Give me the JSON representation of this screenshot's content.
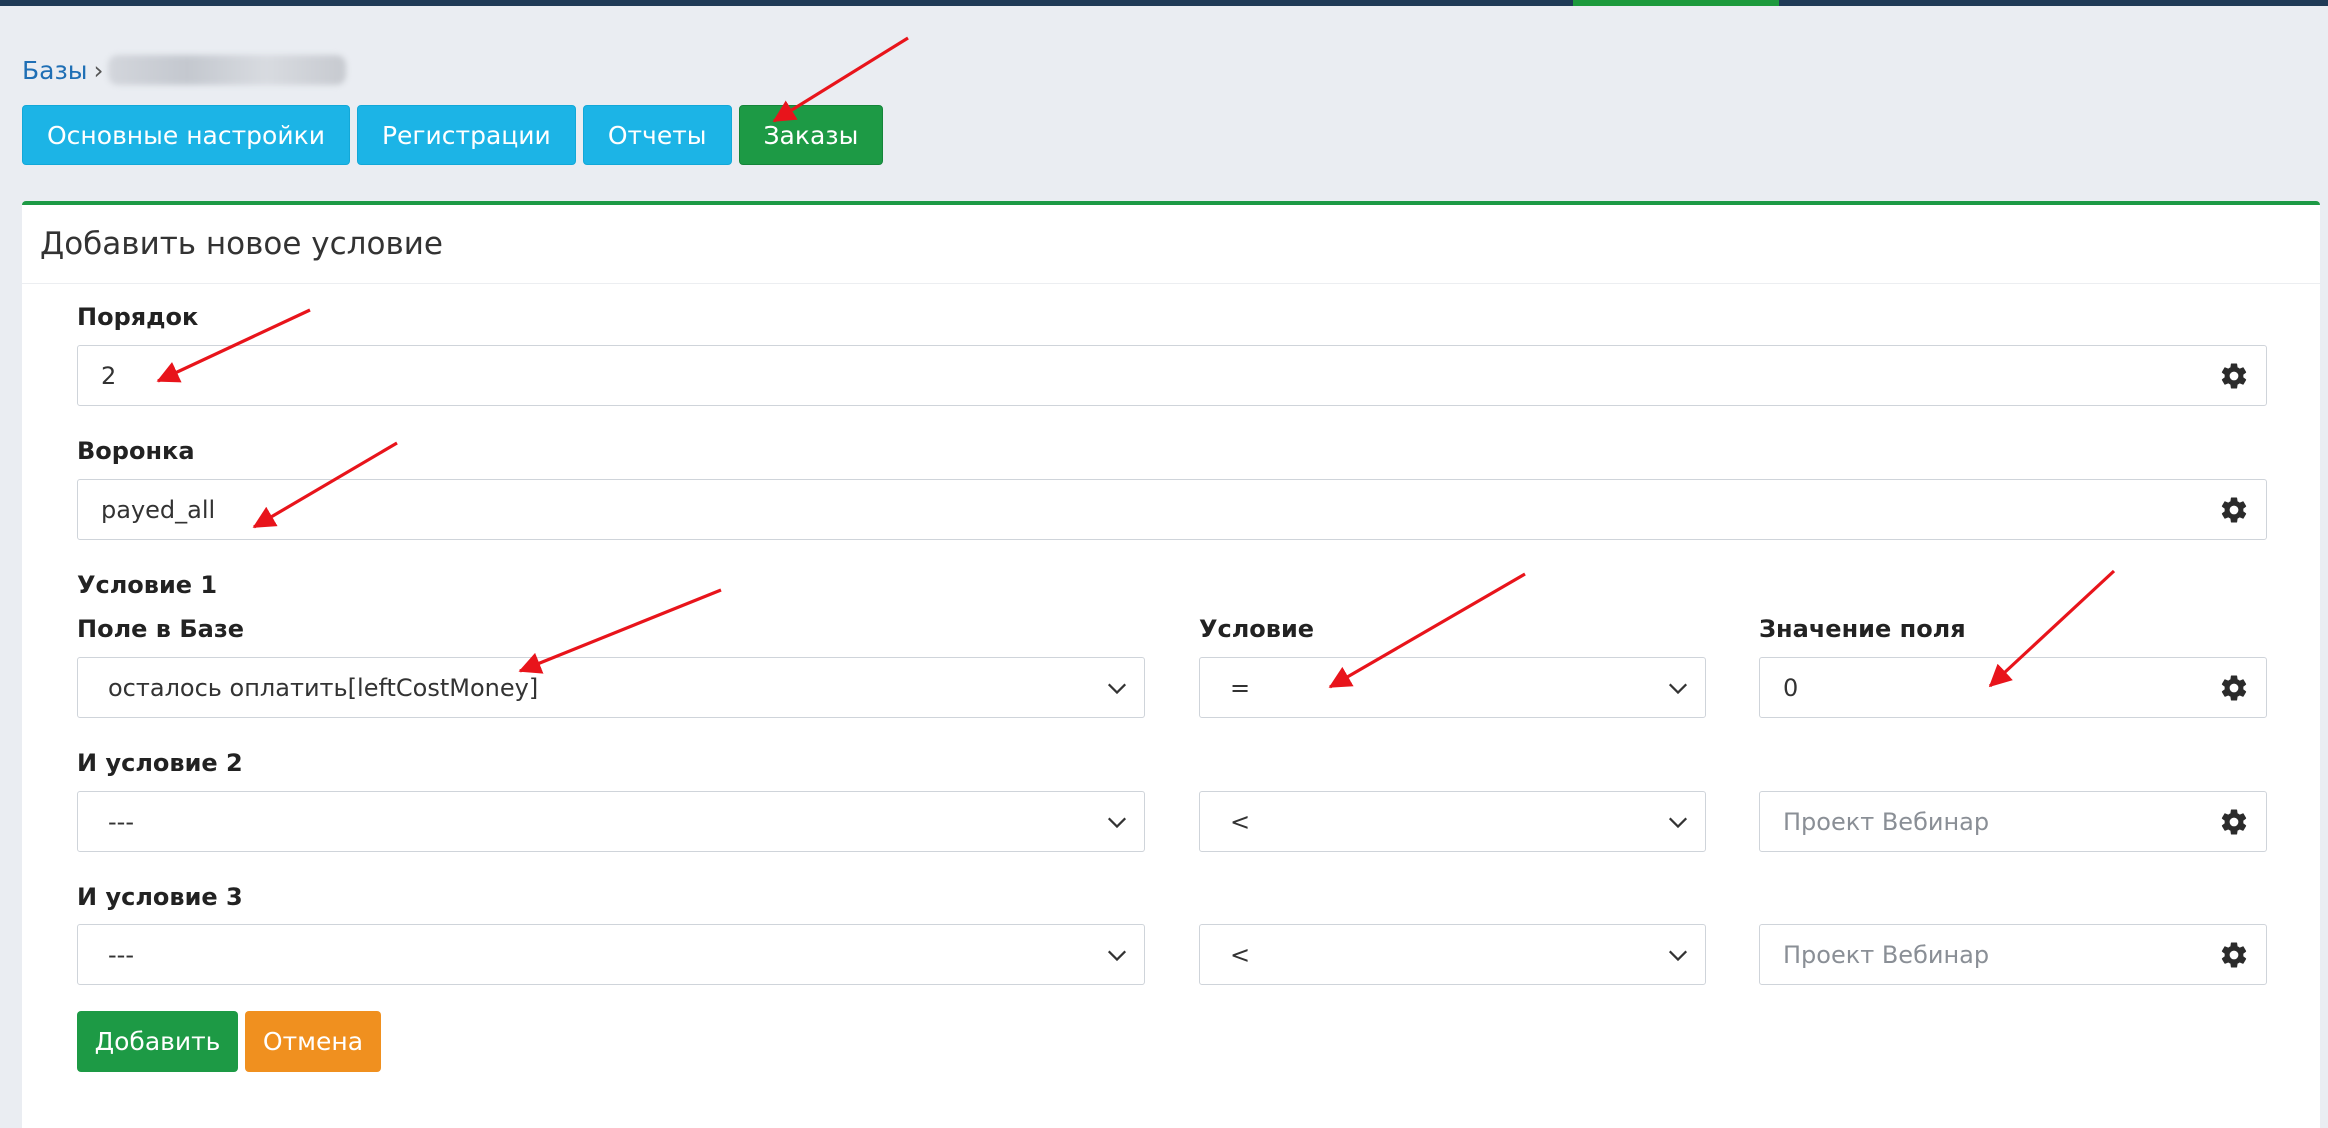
{
  "breadcrumb": {
    "root": "Базы",
    "separator": "›"
  },
  "tabs": [
    {
      "label": "Основные настройки"
    },
    {
      "label": "Регистрации"
    },
    {
      "label": "Отчеты"
    },
    {
      "label": "Заказы",
      "active": true
    }
  ],
  "form": {
    "title": "Добавить новое условие",
    "order": {
      "label": "Порядок",
      "value": "2"
    },
    "funnel": {
      "label": "Воронка",
      "value": "payed_all"
    },
    "condition1": {
      "section_label": "Условие 1",
      "db_field_label": "Поле в Базе",
      "db_field_value": "осталось оплатить[leftCostMoney]",
      "operator_label": "Условие",
      "operator_value": "=",
      "value_label": "Значение поля",
      "value": "0"
    },
    "condition2": {
      "section_label": "И условие 2",
      "db_field_value": "---",
      "operator_value": "<",
      "value_placeholder": "Проект Вебинар"
    },
    "condition3": {
      "section_label": "И условие 3",
      "db_field_value": "---",
      "operator_value": "<",
      "value_placeholder": "Проект Вебинар"
    },
    "buttons": {
      "add": "Добавить",
      "cancel": "Отмена"
    }
  },
  "colors": {
    "tab": "#1cb4e6",
    "active_tab": "#1d9a45",
    "add_button": "#1d9a45",
    "cancel_button": "#f0901f",
    "annotation_arrow": "#e8141b"
  },
  "icons": [
    "gear-icon",
    "chevron-down-icon",
    "annotation-arrow"
  ]
}
